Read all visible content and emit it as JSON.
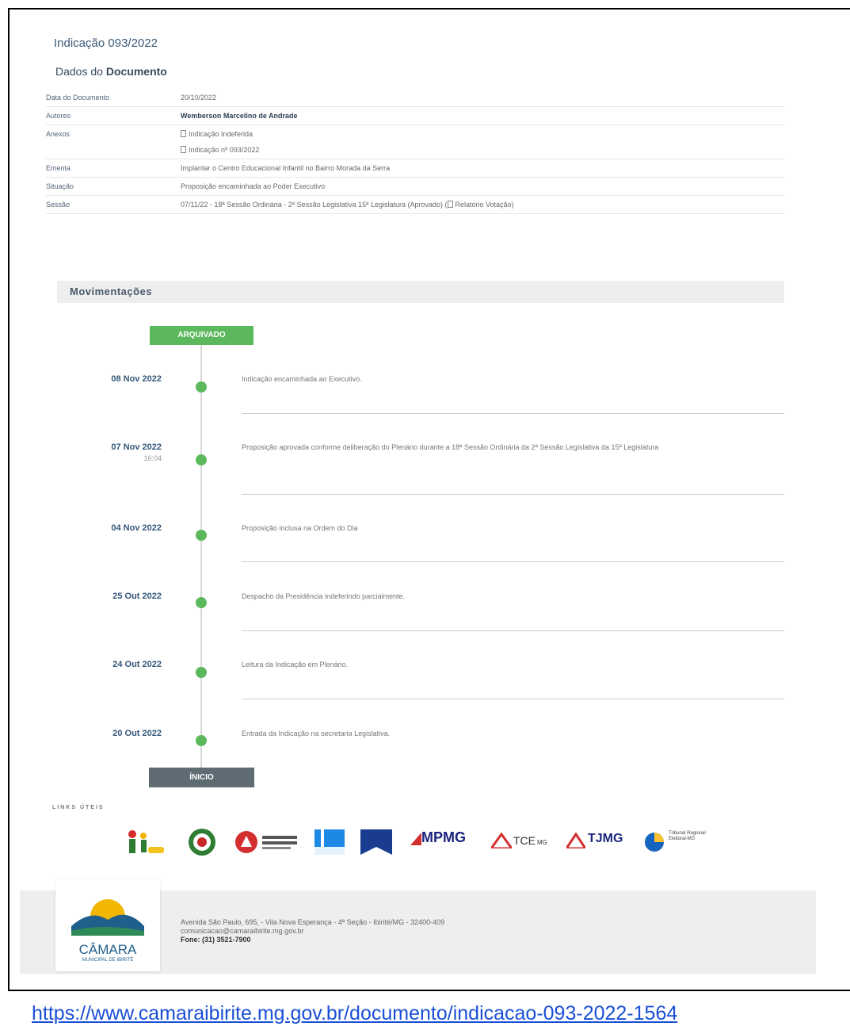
{
  "document": {
    "title": "Indicação 093/2022",
    "subtitle_prefix": "Dados do ",
    "subtitle_bold": "Documento"
  },
  "meta": {
    "date_label": "Data do Documento",
    "date_value": "20/10/2022",
    "authors_label": "Autores",
    "authors_value": "Wemberson Marcelino de Andrade",
    "annex_label": "Anexos",
    "annex_items": [
      "Indicação Indeferida",
      "Indicação nº 093/2022"
    ],
    "ementa_label": "Ementa",
    "ementa_value": "Implantar o Centro Educacional Infantil no Bairro Morada da Serra",
    "status_label": "Situação",
    "status_value": "Proposição encaminhada ao Poder Executivo",
    "session_label": "Sessão",
    "session_value": "07/11/22 - 18ª Sessão Ordinária - 2ª Sessão Legislativa 15ª Legislatura (Aprovado) (",
    "session_link": "Relatório Votação",
    "session_suffix": ")"
  },
  "movements": {
    "header": "Movimentações",
    "top_badge": "ARQUIVADO",
    "bottom_badge": "ÍNICIO",
    "items": [
      {
        "date": "08 Nov 2022",
        "time": "",
        "text": "Indicação encaminhada ao Executivo."
      },
      {
        "date": "07 Nov 2022",
        "time": "16:04",
        "text": "Proposição aprovada conforme deliberação do Plenário durante a 18ª Sessão Ordinária da 2ª Sessão Legislativa da 15ª Legislatura"
      },
      {
        "date": "04 Nov 2022",
        "time": "",
        "text": "Proposição inclusa na Ordem do Dia"
      },
      {
        "date": "25 Out 2022",
        "time": "",
        "text": "Despacho da Presidência indeferindo parcialmente."
      },
      {
        "date": "24 Out 2022",
        "time": "",
        "text": "Leitura da Indicação em Plenário."
      },
      {
        "date": "20 Out 2022",
        "time": "",
        "text": "Entrada da Indicação na secretaria Legislativa."
      }
    ]
  },
  "links": {
    "title": "LINKS ÚTEIS",
    "logo_mpmg": "MPMG",
    "logo_tce": "TCE",
    "logo_tce_sub": "MG",
    "logo_tjmg": "TJMG",
    "logo_trib": "Tribunal Regional Eleitoral-MG"
  },
  "footer": {
    "logo_name": "CÂMARA",
    "logo_sub": "MUNICIPAL DE IBIRITÉ",
    "address": "Avenida São Paulo, 695, - Vila Nova Esperança - 4ª Seção - Ibirité/MG - 32400-409",
    "email": "comunicacao@camaraibirite.mg.gov.br",
    "phone": "Fone: (31) 3521-7900"
  },
  "url": "https://www.camaraibirite.mg.gov.br/documento/indicacao-093-2022-1564",
  "colors": {
    "accent_green": "#5cb85c",
    "badge_gray": "#5f6b73",
    "date_blue": "#34577a",
    "link_blue": "#1a4fd6"
  }
}
